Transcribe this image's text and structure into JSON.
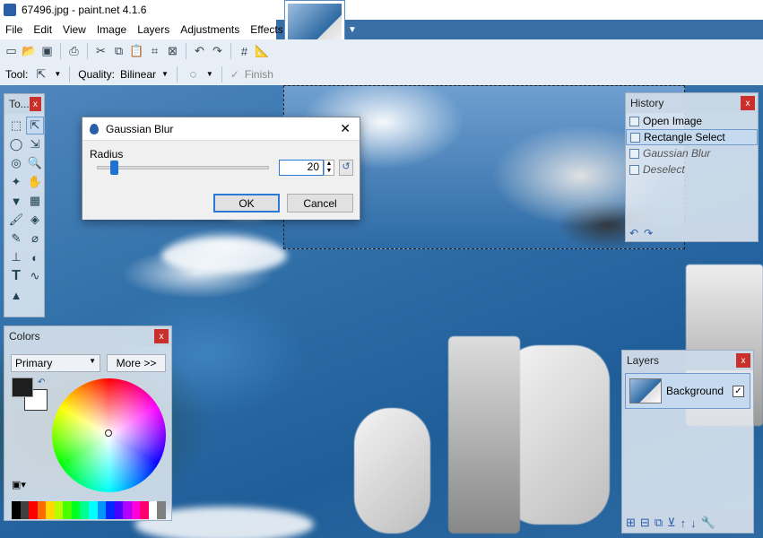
{
  "window": {
    "title": "67496.jpg - paint.net 4.1.6"
  },
  "menu": [
    "File",
    "Edit",
    "View",
    "Image",
    "Layers",
    "Adjustments",
    "Effects"
  ],
  "toolbar2": {
    "tool_label": "Tool:",
    "quality_label": "Quality:",
    "quality_value": "Bilinear",
    "finish_label": "Finish"
  },
  "tools_panel": {
    "title": "To..."
  },
  "dialog": {
    "title": "Gaussian Blur",
    "radius_label": "Radius",
    "radius_value": "20",
    "ok": "OK",
    "cancel": "Cancel",
    "radius_fraction": 0.08
  },
  "history": {
    "title": "History",
    "items": [
      {
        "label": "Open Image",
        "state": "normal"
      },
      {
        "label": "Rectangle Select",
        "state": "selected"
      },
      {
        "label": "Gaussian Blur",
        "state": "dim"
      },
      {
        "label": "Deselect",
        "state": "dim"
      }
    ]
  },
  "colors": {
    "title": "Colors",
    "mode": "Primary",
    "more_label": "More >>",
    "primary": "#1e1e1e",
    "secondary": "#ffffff",
    "palette": [
      "#000000",
      "#404040",
      "#ff0000",
      "#ff6a00",
      "#ffd800",
      "#b6ff00",
      "#4cff00",
      "#00ff21",
      "#00ff90",
      "#00ffff",
      "#0094ff",
      "#0026ff",
      "#4800ff",
      "#b200ff",
      "#ff00dc",
      "#ff006e",
      "#ffffff",
      "#808080"
    ]
  },
  "layers": {
    "title": "Layers",
    "items": [
      {
        "label": "Background",
        "visible": true
      }
    ]
  },
  "close_glyph": "x"
}
